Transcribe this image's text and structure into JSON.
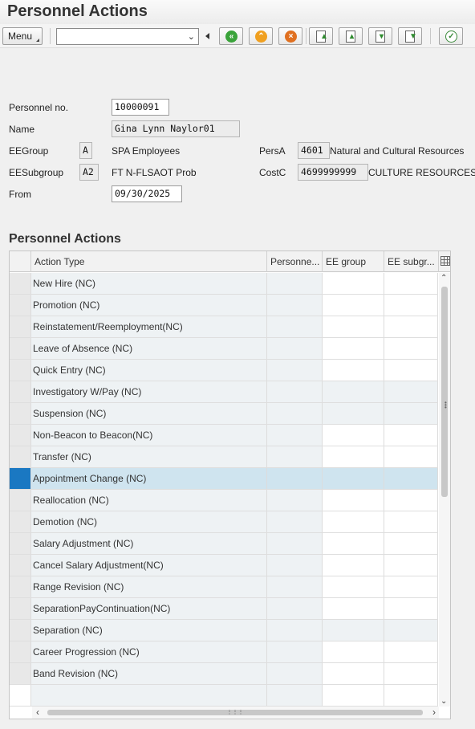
{
  "window": {
    "title": "Personnel Actions"
  },
  "toolbar": {
    "menu_label": "Menu",
    "command_field_value": "",
    "buttons": [
      {
        "icon": "back-icon"
      },
      {
        "icon": "exit-icon"
      },
      {
        "icon": "cancel-icon"
      },
      {
        "icon": "first-page-icon"
      },
      {
        "icon": "previous-page-icon"
      },
      {
        "icon": "next-page-icon"
      },
      {
        "icon": "last-page-icon"
      },
      {
        "icon": "execute-icon"
      }
    ]
  },
  "header": {
    "personnel_no": {
      "label": "Personnel no.",
      "value": "10000091"
    },
    "name": {
      "label": "Name",
      "value": "Gina Lynn Naylor01"
    },
    "eegroup": {
      "label": "EEGroup",
      "code": "A",
      "text": "SPA Employees"
    },
    "eesubgroup": {
      "label": "EESubgroup",
      "code": "A2",
      "text": "FT N-FLSAOT Prob"
    },
    "from": {
      "label": "From",
      "value": "09/30/2025"
    },
    "persa": {
      "label": "PersA",
      "code": "4601",
      "text": "Natural and Cultural Resources"
    },
    "costc": {
      "label": "CostC",
      "code": "4699999999",
      "text": "CULTURE RESOURCES"
    }
  },
  "table": {
    "title": "Personnel Actions",
    "columns": [
      "Action Type",
      "Personne...",
      "EE group",
      "EE subgr..."
    ],
    "rows": [
      {
        "action_type": "New Hire (NC)",
        "readonly_group": false,
        "selected": false
      },
      {
        "action_type": "Promotion (NC)",
        "readonly_group": false,
        "selected": false
      },
      {
        "action_type": "Reinstatement/Reemployment(NC)",
        "readonly_group": false,
        "selected": false
      },
      {
        "action_type": "Leave of Absence (NC)",
        "readonly_group": false,
        "selected": false
      },
      {
        "action_type": "Quick Entry (NC)",
        "readonly_group": false,
        "selected": false
      },
      {
        "action_type": "Investigatory W/Pay (NC)",
        "readonly_group": true,
        "selected": false
      },
      {
        "action_type": "Suspension (NC)",
        "readonly_group": true,
        "selected": false
      },
      {
        "action_type": "Non-Beacon to Beacon(NC)",
        "readonly_group": false,
        "selected": false
      },
      {
        "action_type": "Transfer (NC)",
        "readonly_group": false,
        "selected": false
      },
      {
        "action_type": "Appointment Change (NC)",
        "readonly_group": false,
        "selected": true
      },
      {
        "action_type": "Reallocation (NC)",
        "readonly_group": false,
        "selected": false
      },
      {
        "action_type": "Demotion (NC)",
        "readonly_group": false,
        "selected": false
      },
      {
        "action_type": "Salary Adjustment (NC)",
        "readonly_group": false,
        "selected": false
      },
      {
        "action_type": "Cancel Salary Adjustment(NC)",
        "readonly_group": false,
        "selected": false
      },
      {
        "action_type": "Range Revision (NC)",
        "readonly_group": false,
        "selected": false
      },
      {
        "action_type": "SeparationPayContinuation(NC)",
        "readonly_group": false,
        "selected": false
      },
      {
        "action_type": "Separation (NC)",
        "readonly_group": true,
        "selected": false
      },
      {
        "action_type": "Career Progression (NC)",
        "readonly_group": false,
        "selected": false
      },
      {
        "action_type": "Band Revision (NC)",
        "readonly_group": false,
        "selected": false
      },
      {
        "action_type": "",
        "readonly_group": false,
        "selected": false,
        "empty": true
      }
    ]
  },
  "colors": {
    "selected_row_marker": "#1a78c2",
    "selected_row_bg": "#cfe4ef",
    "readonly_cell_bg": "#eef2f4"
  }
}
